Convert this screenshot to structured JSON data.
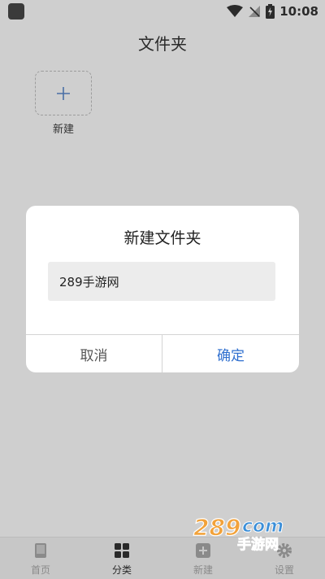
{
  "status_bar": {
    "time": "10:08"
  },
  "page": {
    "title": "文件夹"
  },
  "new_folder_tile": {
    "label": "新建"
  },
  "dialog": {
    "title": "新建文件夹",
    "input_value": "289手游网",
    "cancel_label": "取消",
    "confirm_label": "确定"
  },
  "tab_bar": {
    "tabs": [
      {
        "label": "首页",
        "icon": "book-icon"
      },
      {
        "label": "分类",
        "icon": "grid-icon"
      },
      {
        "label": "新建",
        "icon": "add-square-icon"
      },
      {
        "label": "设置",
        "icon": "gear-icon"
      }
    ]
  },
  "watermark": {
    "text": "289手游网",
    "brand": "289com"
  },
  "colors": {
    "accent": "#2f6fcf",
    "background": "#cfcfcf",
    "dialog": "#ffffff",
    "input": "#ececec"
  }
}
